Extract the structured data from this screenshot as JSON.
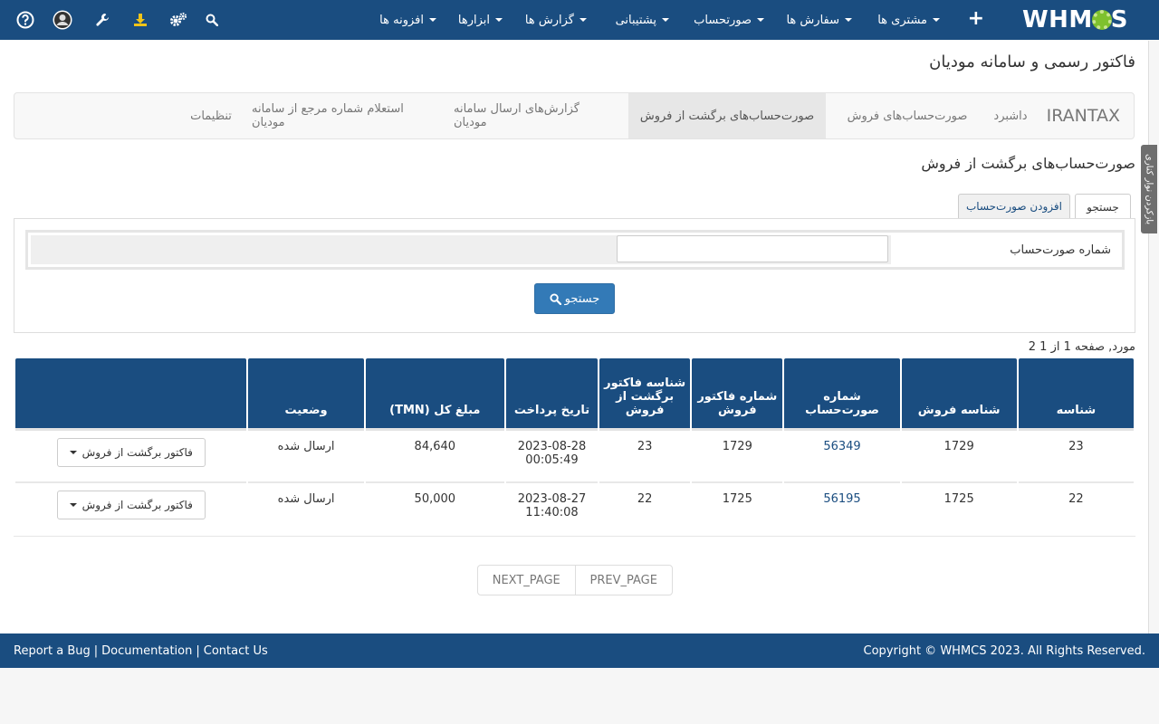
{
  "logo": {
    "left": "WHM",
    "right": "S"
  },
  "nav": [
    {
      "label": "مشتری ها"
    },
    {
      "label": "سفارش ها"
    },
    {
      "label": "صورتحساب"
    },
    {
      "label": "پشتیبانی"
    },
    {
      "label": "گزارش ها"
    },
    {
      "label": "ابزارها"
    },
    {
      "label": "افزونه ها"
    }
  ],
  "page_title": "فاکتور رسمی و سامانه مودیان",
  "tabs": {
    "brand": "IRANTAX",
    "items": [
      {
        "label": "داشبرد"
      },
      {
        "label": "صورت‌حساب‌های فروش"
      },
      {
        "label": "صورت‌حساب‌های برگشت از فروش"
      },
      {
        "label": "گزارش‌های ارسال سامانه مودیان"
      },
      {
        "label": "استعلام شماره مرجع از سامانه مودیان"
      },
      {
        "label": "تنظیمات"
      }
    ]
  },
  "section_title": "صورت‌حساب‌های برگشت از فروش",
  "side_tab": "بازکردن نوار کناری",
  "search_tabs": {
    "search": "جستجو",
    "add": "افزودن صورت‌حساب"
  },
  "search": {
    "field_label": "شماره صورت‌حساب",
    "field_value": "",
    "button": "جستجو"
  },
  "count_text": "2 مورد, صفحه 1 از 1",
  "table": {
    "headers": [
      "شناسه",
      "شناسه فروش",
      "شماره صورت‌حساب",
      "شماره فاکتور فروش",
      "شناسه فاکتور برگشت از فروش",
      "تاریخ پرداخت",
      "مبلغ کل (TMN)",
      "وضعیت",
      ""
    ],
    "rows": [
      {
        "id": "23",
        "sale_id": "1729",
        "invoice": "56349",
        "sale_invoice": "1729",
        "return_id": "23",
        "date": "2023-08-28",
        "time": "00:05:49",
        "total": "84,640",
        "status": "ارسال شده",
        "action": "فاکتور برگشت از فروش"
      },
      {
        "id": "22",
        "sale_id": "1725",
        "invoice": "56195",
        "sale_invoice": "1725",
        "return_id": "22",
        "date": "2023-08-27",
        "time": "11:40:08",
        "total": "50,000",
        "status": "ارسال شده",
        "action": "فاکتور برگشت از فروش"
      }
    ]
  },
  "pager": {
    "next": "NEXT_PAGE",
    "prev": "PREV_PAGE"
  },
  "footer": {
    "links": [
      "Report a Bug",
      "Documentation",
      "Contact Us"
    ],
    "separator": "|",
    "copyright": "Copyright © WHMCS 2023. All Rights Reserved."
  },
  "colors": {
    "header": "#1a4d80",
    "primary_button": "#337ab7",
    "logo_gear": "#7ec12e",
    "download_icon": "#f0c419"
  },
  "icons": [
    "plus-icon",
    "search-icon",
    "gears-icon",
    "download-icon",
    "wrench-icon",
    "avatar",
    "help-icon"
  ]
}
